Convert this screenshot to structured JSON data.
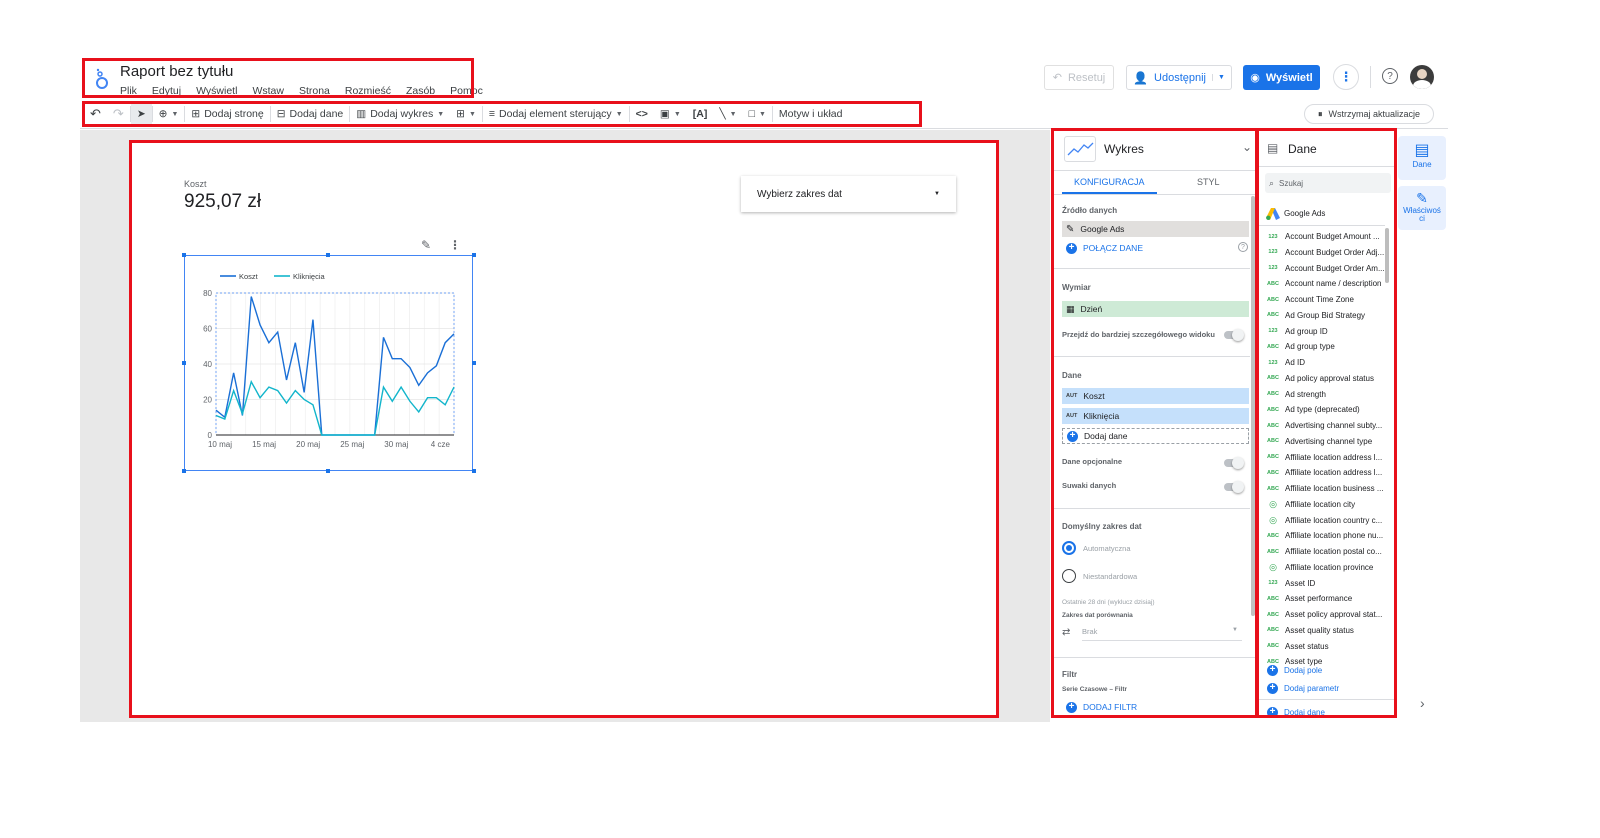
{
  "header": {
    "title": "Raport bez tytułu",
    "menu": [
      "Plik",
      "Edytuj",
      "Wyświetl",
      "Wstaw",
      "Strona",
      "Rozmieść",
      "Zasób",
      "Pomoc"
    ],
    "reset_label": "Resetuj",
    "share_label": "Udostępnij",
    "view_label": "Wyświetl"
  },
  "toolbar": {
    "add_page": "Dodaj stronę",
    "add_data": "Dodaj dane",
    "add_chart": "Dodaj wykres",
    "add_control": "Dodaj element sterujący",
    "theme": "Motyw i układ",
    "pause": "Wstrzymaj aktualizacje"
  },
  "canvas": {
    "scorecard_label": "Koszt",
    "scorecard_value": "925,07 zł",
    "date_picker": "Wybierz zakres dat"
  },
  "chart_data": {
    "type": "line",
    "legend_position": "top-left",
    "x_tick_labels": [
      "10 maj",
      "15 maj",
      "20 maj",
      "25 maj",
      "30 maj",
      "4 cze"
    ],
    "y_ticks": [
      0,
      20,
      40,
      60,
      80
    ],
    "ylim": [
      0,
      80
    ],
    "grid": true,
    "x": [
      1,
      2,
      3,
      4,
      5,
      6,
      7,
      8,
      9,
      10,
      11,
      12,
      13,
      14,
      15,
      16,
      17,
      18,
      19,
      20,
      21,
      22,
      23,
      24,
      25,
      26,
      27,
      28,
      29,
      30,
      31,
      32
    ],
    "series": [
      {
        "name": "Koszt",
        "color": "#1a6fd6",
        "values": [
          14,
          10,
          35,
          11,
          78,
          62,
          52,
          58,
          31,
          52,
          24,
          65,
          0,
          0,
          0,
          0,
          0,
          0,
          0,
          55,
          43,
          43,
          38,
          28,
          35,
          39,
          52,
          57
        ]
      },
      {
        "name": "Kliknięcia",
        "color": "#12b5cb",
        "values": [
          11,
          9,
          25,
          12,
          30,
          21,
          27,
          25,
          18,
          25,
          20,
          17,
          0,
          0,
          0,
          0,
          0,
          0,
          0,
          27,
          19,
          27,
          19,
          13,
          21,
          21,
          17,
          27
        ]
      }
    ]
  },
  "chart_panel": {
    "title": "Wykres",
    "tab_config": "KONFIGURACJA",
    "tab_style": "STYL",
    "source_title": "Źródło danych",
    "source_name": "Google Ads",
    "connect": "POŁĄCZ DANE",
    "dimension_title": "Wymiar",
    "dimension": "Dzień",
    "drilldown": "Przejdź do bardziej szczegółowego widoku",
    "metrics_title": "Dane",
    "metric_badge": "AUT",
    "metric1": "Koszt",
    "metric2": "Kliknięcia",
    "add_metric": "Dodaj dane",
    "optional": "Dane opcjonalne",
    "sliders": "Suwaki danych",
    "date_title": "Domyślny zakres dat",
    "auto": "Automatyczna",
    "custom": "Niestandardowa",
    "last28": "Ostatnie 28 dni (wyklucz dzisiaj)",
    "compare_title": "Zakres dat porównania",
    "compare_value": "Brak",
    "filter_title": "Filtr",
    "filter_sub": "Serie Czasowe – Filtr",
    "add_filter": "DODAJ FILTR"
  },
  "data_panel": {
    "title": "Dane",
    "search_placeholder": "Szukaj",
    "source": "Google Ads",
    "fields": [
      {
        "t": "123",
        "name": "Account Budget Amount ..."
      },
      {
        "t": "123",
        "name": "Account Budget Order Adj..."
      },
      {
        "t": "123",
        "name": "Account Budget Order Am..."
      },
      {
        "t": "ABC",
        "name": "Account name / description"
      },
      {
        "t": "ABC",
        "name": "Account Time Zone"
      },
      {
        "t": "ABC",
        "name": "Ad Group Bid Strategy"
      },
      {
        "t": "123",
        "name": "Ad group ID"
      },
      {
        "t": "ABC",
        "name": "Ad group type"
      },
      {
        "t": "123",
        "name": "Ad ID"
      },
      {
        "t": "ABC",
        "name": "Ad policy approval status"
      },
      {
        "t": "ABC",
        "name": "Ad strength"
      },
      {
        "t": "ABC",
        "name": "Ad type (deprecated)"
      },
      {
        "t": "ABC",
        "name": "Advertising channel subty..."
      },
      {
        "t": "ABC",
        "name": "Advertising channel type"
      },
      {
        "t": "ABC",
        "name": "Affiliate location address l..."
      },
      {
        "t": "ABC",
        "name": "Affiliate location address l..."
      },
      {
        "t": "ABC",
        "name": "Affiliate location business ..."
      },
      {
        "t": "GEO",
        "name": "Affiliate location city"
      },
      {
        "t": "GEO",
        "name": "Affiliate location country c..."
      },
      {
        "t": "ABC",
        "name": "Affiliate location phone nu..."
      },
      {
        "t": "ABC",
        "name": "Affiliate location postal co..."
      },
      {
        "t": "GEO",
        "name": "Affiliate location province"
      },
      {
        "t": "123",
        "name": "Asset ID"
      },
      {
        "t": "ABC",
        "name": "Asset performance"
      },
      {
        "t": "ABC",
        "name": "Asset policy approval stat..."
      },
      {
        "t": "ABC",
        "name": "Asset quality status"
      },
      {
        "t": "ABC",
        "name": "Asset status"
      },
      {
        "t": "ABC",
        "name": "Asset type"
      }
    ],
    "add_field": "Dodaj pole",
    "add_param": "Dodaj parametr",
    "add_data": "Dodaj dane"
  },
  "rail": {
    "data": "Dane",
    "props": "Właściwości"
  }
}
